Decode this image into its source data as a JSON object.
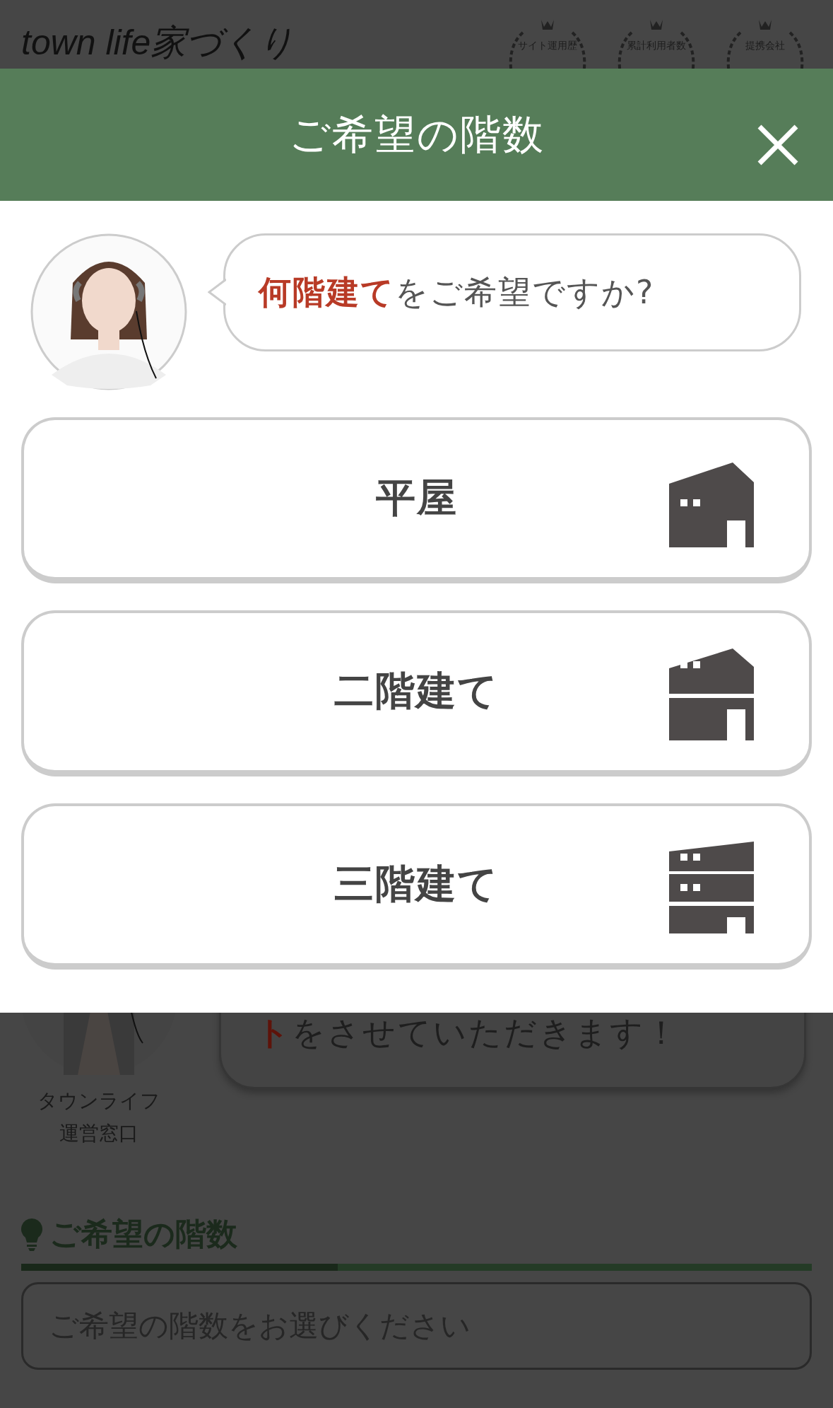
{
  "site_header": {
    "logo": "town life家づくり",
    "badges": [
      {
        "label": "サイト運用歴"
      },
      {
        "label": "累計利用者数"
      },
      {
        "label": "提携会社"
      }
    ]
  },
  "background": {
    "message": {
      "highlight": "ト",
      "rest": "をさせていただきます！"
    },
    "operator_name": [
      "タウンライフ",
      "運営窓口"
    ],
    "section_title": "ご希望の階数",
    "progress": {
      "level": 0.4
    },
    "select": {
      "placeholder": "ご希望の階数をお選びください"
    }
  },
  "modal": {
    "title": "ご希望の階数",
    "question": {
      "highlight": "何階建て",
      "rest": "をご希望ですか?"
    },
    "options": [
      {
        "label": "平屋",
        "kind": "one-story"
      },
      {
        "label": "二階建て",
        "kind": "two-story"
      },
      {
        "label": "三階建て",
        "kind": "three-story"
      }
    ]
  }
}
